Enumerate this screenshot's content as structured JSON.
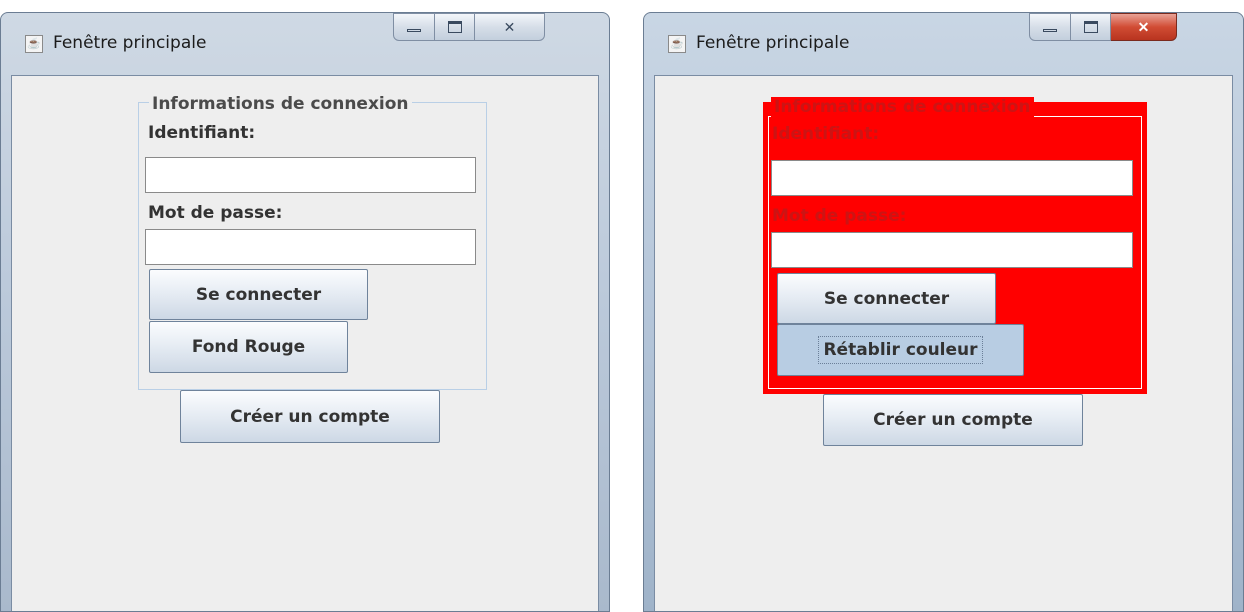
{
  "windows": [
    {
      "title": "Fenêtre principale",
      "legend": "Informations de connexion",
      "username_label": "Identifiant:",
      "username_value": "",
      "password_label": "Mot de passe:",
      "password_value": "",
      "connect_button": "Se connecter",
      "color_button": "Fond Rouge",
      "create_button": "Créer un compte"
    },
    {
      "title": "Fenêtre principale",
      "legend": "Informations de connexion",
      "username_label": "Identifiant:",
      "username_value": "",
      "password_label": "Mot de passe:",
      "password_value": "",
      "connect_button": "Se connecter",
      "color_button": "Rétablir couleur",
      "create_button": "Créer un compte",
      "panel_color": "#ff0000"
    }
  ],
  "icons": {
    "app": "java-app-icon",
    "minimize": "minimize-icon",
    "maximize": "maximize-icon",
    "close": "close-icon"
  }
}
